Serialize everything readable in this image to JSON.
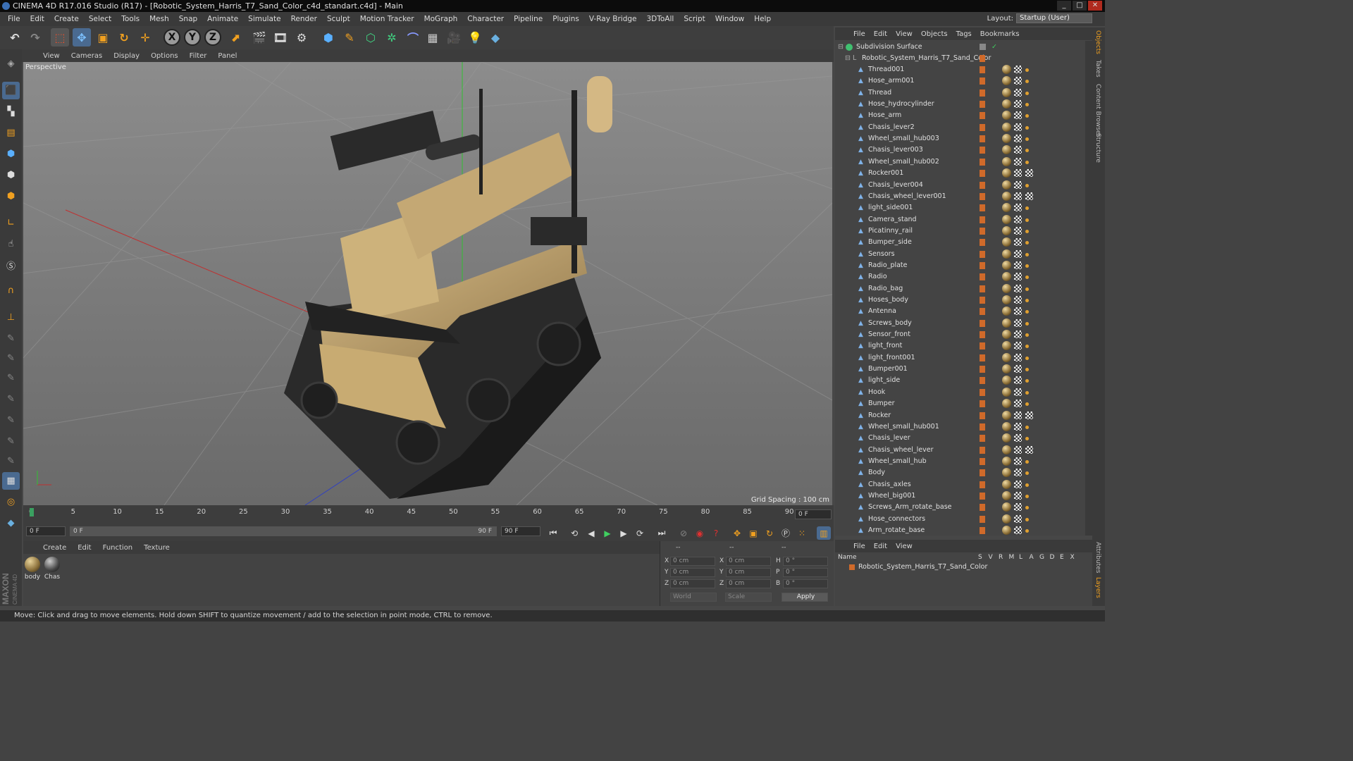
{
  "window": {
    "title": "CINEMA 4D R17.016 Studio (R17) - [Robotic_System_Harris_T7_Sand_Color_c4d_standart.c4d] - Main",
    "controls": [
      "_",
      "□",
      "✕"
    ]
  },
  "menu": [
    "File",
    "Edit",
    "Create",
    "Select",
    "Tools",
    "Mesh",
    "Snap",
    "Animate",
    "Simulate",
    "Render",
    "Sculpt",
    "Motion Tracker",
    "MoGraph",
    "Character",
    "Pipeline",
    "Plugins",
    "V-Ray Bridge",
    "3DToAll",
    "Script",
    "Window",
    "Help"
  ],
  "layout": {
    "label": "Layout:",
    "value": "Startup (User)"
  },
  "toolbar": {
    "axes": [
      "X",
      "Y",
      "Z"
    ]
  },
  "viewport": {
    "menu": [
      "View",
      "Cameras",
      "Display",
      "Options",
      "Filter",
      "Panel"
    ],
    "label": "Perspective",
    "grid_spacing": "Grid Spacing : 100 cm"
  },
  "timeline": {
    "ticks": [
      "0",
      "5",
      "10",
      "15",
      "20",
      "25",
      "30",
      "35",
      "40",
      "45",
      "50",
      "55",
      "60",
      "65",
      "70",
      "75",
      "80",
      "85",
      "90"
    ],
    "frame_field": "0 F"
  },
  "transport": {
    "start": "0 F",
    "range_start": "0 F",
    "range_end": "90 F",
    "end": "90 F"
  },
  "materials": {
    "menu": [
      "Create",
      "Edit",
      "Function",
      "Texture"
    ],
    "items": [
      "body",
      "Chas"
    ]
  },
  "coords": {
    "headers": [
      "--",
      "--",
      "--"
    ],
    "rows": [
      {
        "a": "X",
        "v1": "0 cm",
        "b": "X",
        "v2": "0 cm",
        "c": "H",
        "v3": "0 °"
      },
      {
        "a": "Y",
        "v1": "0 cm",
        "b": "Y",
        "v2": "0 cm",
        "c": "P",
        "v3": "0 °"
      },
      {
        "a": "Z",
        "v1": "0 cm",
        "b": "Z",
        "v2": "0 cm",
        "c": "B",
        "v3": "0 °"
      }
    ],
    "world": "World",
    "scale": "Scale",
    "apply": "Apply"
  },
  "objects": {
    "menu": [
      "File",
      "Edit",
      "View",
      "Objects",
      "Tags",
      "Bookmarks"
    ],
    "root": "Subdivision Surface",
    "group": "Robotic_System_Harris_T7_Sand_Color",
    "items": [
      "Thread001",
      "Hose_arm001",
      "Thread",
      "Hose_hydrocylinder",
      "Hose_arm",
      "Chasis_lever2",
      "Wheel_small_hub003",
      "Chasis_lever003",
      "Wheel_small_hub002",
      "Rocker001",
      "Chasis_lever004",
      "Chasis_wheel_lever001",
      "light_side001",
      "Camera_stand",
      "Picatinny_rail",
      "Bumper_side",
      "Sensors",
      "Radio_plate",
      "Radio",
      "Radio_bag",
      "Hoses_body",
      "Antenna",
      "Screws_body",
      "Sensor_front",
      "light_front",
      "light_front001",
      "Bumper001",
      "light_side",
      "Hook",
      "Bumper",
      "Rocker",
      "Wheel_small_hub001",
      "Chasis_lever",
      "Chasis_wheel_lever",
      "Wheel_small_hub",
      "Body",
      "Chasis_axles",
      "Wheel_big001",
      "Screws_Arm_rotate_base",
      "Hose_connectors",
      "Arm_rotate_base"
    ]
  },
  "layers": {
    "menu": [
      "File",
      "Edit",
      "View"
    ],
    "col_name": "Name",
    "cols": [
      "S",
      "V",
      "R",
      "M",
      "L",
      "A",
      "G",
      "D",
      "E",
      "X"
    ],
    "item": "Robotic_System_Harris_T7_Sand_Color"
  },
  "right_tabs": [
    "Objects",
    "Takes",
    "Content Browser",
    "Structure"
  ],
  "right_tabs_bottom": [
    "Attributes",
    "Layers"
  ],
  "maxon": [
    "MAXON",
    "CINEMA 4D"
  ],
  "status": "Move: Click and drag to move elements. Hold down SHIFT to quantize movement / add to the selection in point mode, CTRL to remove."
}
